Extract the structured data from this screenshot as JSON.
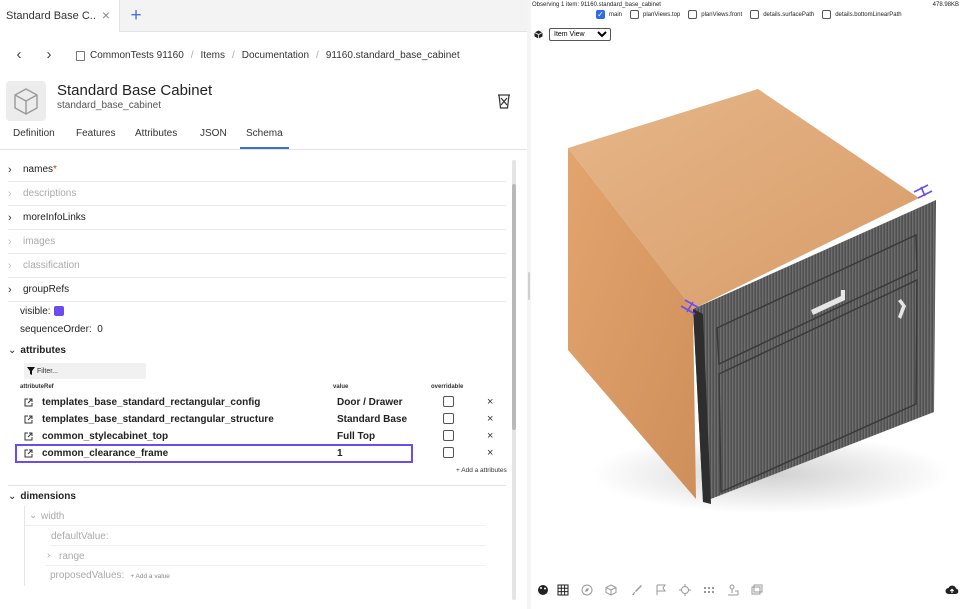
{
  "tab": {
    "title": "Standard Base C...",
    "close": "×",
    "new": "+"
  },
  "breadcrumb": {
    "back": "‹",
    "forward": "›",
    "items": [
      "CommonTests 91160",
      "Items",
      "Documentation",
      "91160.standard_base_cabinet"
    ],
    "separator": "/"
  },
  "item": {
    "title": "Standard Base Cabinet",
    "subtitle": "standard_base_cabinet"
  },
  "detail_tabs": [
    "Definition",
    "Features",
    "Attributes",
    "JSON",
    "Schema"
  ],
  "active_tab": "Schema",
  "schema": {
    "sections": [
      {
        "label": "names",
        "required": "*",
        "enabled": true
      },
      {
        "label": "descriptions",
        "enabled": false
      },
      {
        "label": "moreInfoLinks",
        "enabled": true
      },
      {
        "label": "images",
        "enabled": false
      },
      {
        "label": "classification",
        "enabled": false
      },
      {
        "label": "groupRefs",
        "enabled": true
      }
    ],
    "visible_label": "visible:",
    "visible_checked": true,
    "sequence_label": "sequenceOrder:",
    "sequence_value": "0",
    "attributes_label": "attributes",
    "filter_placeholder": "Filter...",
    "columns": {
      "ref": "attributeRef",
      "value": "value",
      "overridable": "overridable"
    },
    "attributes": [
      {
        "ref": "templates_base_standard_rectangular_config",
        "value": "Door / Drawer",
        "overridable": false,
        "selected": false
      },
      {
        "ref": "templates_base_standard_rectangular_structure",
        "value": "Standard Base",
        "overridable": false,
        "selected": false
      },
      {
        "ref": "common_stylecabinet_top",
        "value": "Full Top",
        "overridable": false,
        "selected": false
      },
      {
        "ref": "common_clearance_frame",
        "value": "1",
        "overridable": false,
        "selected": true
      }
    ],
    "delete_glyph": "×",
    "add_attribute": "+ Add a attributes",
    "dimensions_label": "dimensions",
    "width_label": "width",
    "default_value_label": "defaultValue:",
    "range_label": "range",
    "proposed_values_label": "proposedValues:",
    "add_value": "+ Add a value"
  },
  "viewer": {
    "observing": "Observing 1 item: 91160.standard_base_cabinet",
    "size": "478.98KB",
    "checkboxes": [
      {
        "label": "main",
        "checked": true
      },
      {
        "label": "planViews.top",
        "checked": false
      },
      {
        "label": "planViews.front",
        "checked": false
      },
      {
        "label": "details.surfacePath",
        "checked": false
      },
      {
        "label": "details.bottomLinearPath",
        "checked": false
      }
    ],
    "view_mode": "Item View",
    "colors": {
      "accent": "#6b4cf0",
      "checkbox": "#2d6be4",
      "top_face": "#dfa97b",
      "side_face": "#e0a46f",
      "front_face": "#5a5a5a"
    }
  },
  "toolbar_icons": [
    "palette-icon",
    "grid-icon",
    "compass-icon",
    "cube-icon",
    "brush-icon",
    "flag-icon",
    "crosshair-icon",
    "dots-grid-icon",
    "pin-icon",
    "image-icon",
    "cloud-upload-icon"
  ]
}
